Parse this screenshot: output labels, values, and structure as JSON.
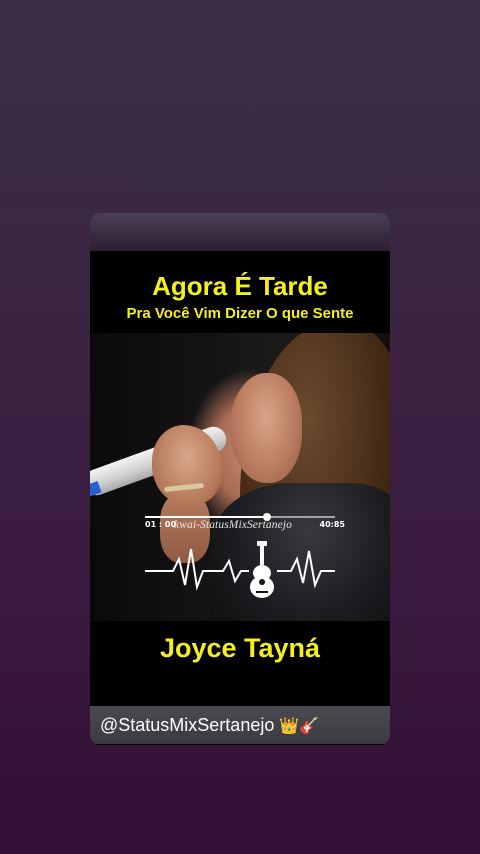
{
  "video": {
    "title": "Agora É Tarde",
    "lyric_line": "Pra Você Vim Dizer O que Sente",
    "artist": "Joyce Tayná",
    "watermark": "kwai-StatusMixSertanejo",
    "player": {
      "time_current": "01 : 00",
      "time_total": "40:85",
      "progress_fraction": 0.64
    },
    "handle": {
      "text": "@StatusMixSertanejo",
      "emoji": "👑🎸"
    }
  },
  "colors": {
    "title_yellow": "#f4ef20",
    "background_top": "#3a2f46",
    "background_bottom": "#320f34"
  },
  "icons": [
    "heartbeat-guitar-icon",
    "crown-emoji",
    "guitar-emoji"
  ]
}
